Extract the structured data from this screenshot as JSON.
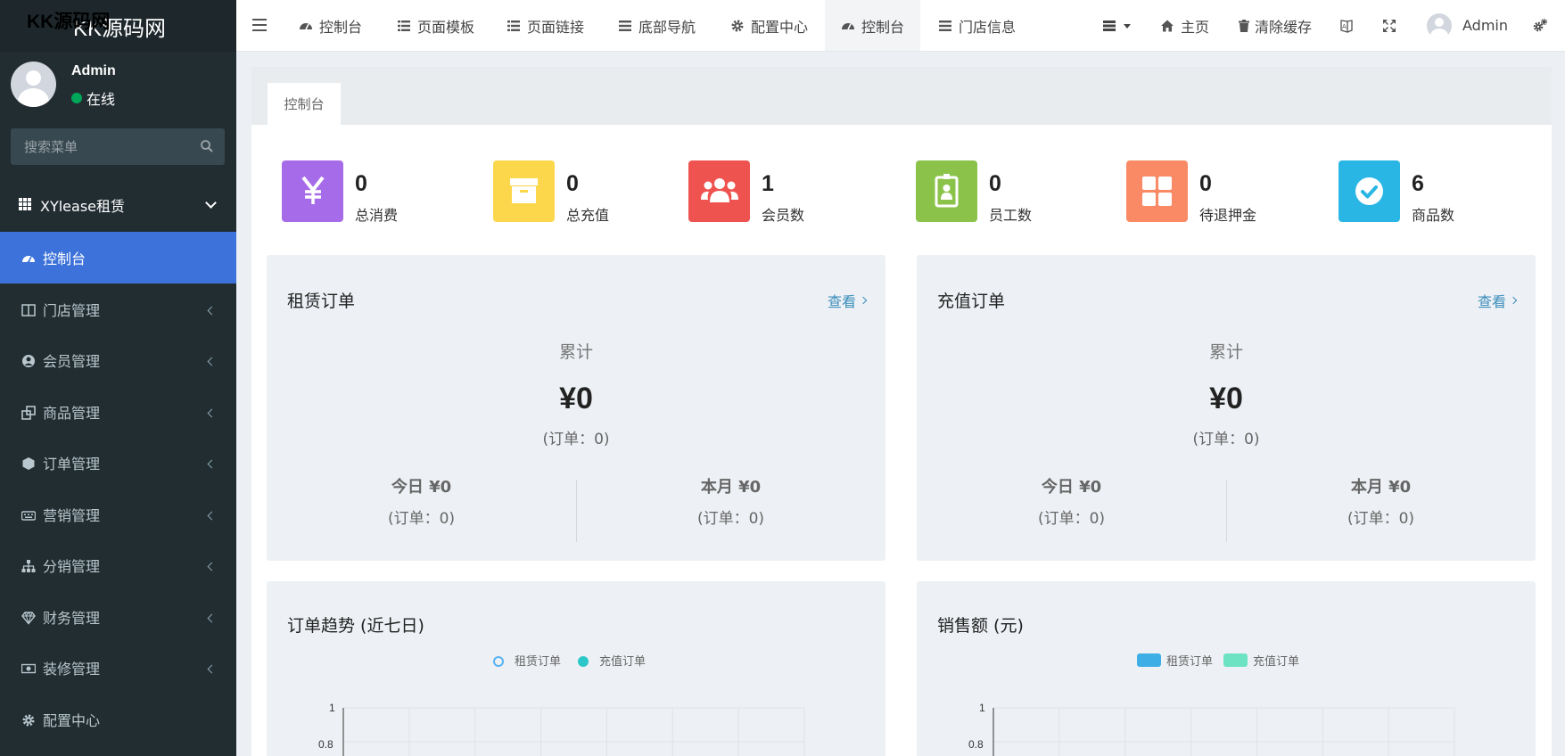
{
  "brand": {
    "logo": "KK源码网",
    "watermark": "KK源码网"
  },
  "user": {
    "name": "Admin",
    "status": "在线"
  },
  "sidebar": {
    "search_placeholder": "搜索菜单",
    "group": "XYlease租赁",
    "items": [
      {
        "label": "控制台",
        "icon": "dashboard-icon",
        "active": true
      },
      {
        "label": "门店管理",
        "icon": "columns-icon"
      },
      {
        "label": "会员管理",
        "icon": "user-circle-icon"
      },
      {
        "label": "商品管理",
        "icon": "clone-icon"
      },
      {
        "label": "订单管理",
        "icon": "cube-icon"
      },
      {
        "label": "营销管理",
        "icon": "keyboard-icon"
      },
      {
        "label": "分销管理",
        "icon": "sitemap-icon"
      },
      {
        "label": "财务管理",
        "icon": "diamond-icon"
      },
      {
        "label": "装修管理",
        "icon": "money-icon"
      },
      {
        "label": "配置中心",
        "icon": "gear-icon"
      }
    ]
  },
  "navbar": {
    "tabs": [
      {
        "label": "控制台",
        "icon": "dashboard-icon"
      },
      {
        "label": "页面模板",
        "icon": "list-icon"
      },
      {
        "label": "页面链接",
        "icon": "list-icon"
      },
      {
        "label": "底部导航",
        "icon": "bars-icon"
      },
      {
        "label": "配置中心",
        "icon": "gear-icon"
      },
      {
        "label": "控制台",
        "icon": "dashboard-icon",
        "active": true
      },
      {
        "label": "门店信息",
        "icon": "bars-icon"
      }
    ],
    "right": {
      "home": "主页",
      "clear_cache": "清除缓存",
      "admin": "Admin"
    }
  },
  "content": {
    "tab": "控制台",
    "stats": [
      {
        "value": "0",
        "label": "总消费",
        "color": "#a66be8",
        "icon": "yen-icon"
      },
      {
        "value": "0",
        "label": "总充值",
        "color": "#fdd74b",
        "icon": "archive-icon"
      },
      {
        "value": "1",
        "label": "会员数",
        "color": "#ef5350",
        "icon": "users-icon"
      },
      {
        "value": "0",
        "label": "员工数",
        "color": "#8bc34a",
        "icon": "id-badge-icon"
      },
      {
        "value": "0",
        "label": "待退押金",
        "color": "#fa8a65",
        "icon": "th-large-icon"
      },
      {
        "value": "6",
        "label": "商品数",
        "color": "#29b6e5",
        "icon": "check-circle-icon"
      }
    ],
    "rental": {
      "title": "租赁订单",
      "link": "查看",
      "cum_label": "累计",
      "cum_amount": "¥0",
      "cum_orders": "(订单：0)",
      "today": "今日 ¥0",
      "today_orders": "(订单：0)",
      "month": "本月 ¥0",
      "month_orders": "(订单：0)"
    },
    "recharge": {
      "title": "充值订单",
      "link": "查看",
      "cum_label": "累计",
      "cum_amount": "¥0",
      "cum_orders": "(订单：0)",
      "today": "今日 ¥0",
      "today_orders": "(订单：0)",
      "month": "本月 ¥0",
      "month_orders": "(订单：0)"
    }
  },
  "chart_data": [
    {
      "type": "line",
      "title": "订单趋势 (近七日)",
      "series": [
        {
          "name": "租赁订单",
          "values": []
        },
        {
          "name": "充值订单",
          "values": []
        }
      ],
      "colors": [
        "#5ab1ef",
        "#2ec7c9"
      ],
      "ylim": [
        0,
        1
      ],
      "yticks": [
        "1",
        "0.8"
      ]
    },
    {
      "type": "bar",
      "title": "销售额 (元)",
      "series": [
        {
          "name": "租赁订单",
          "values": []
        },
        {
          "name": "充值订单",
          "values": []
        }
      ],
      "colors": [
        "#3eaee6",
        "#6de3c4"
      ],
      "ylim": [
        0,
        1
      ],
      "yticks": [
        "1",
        "0.8"
      ]
    }
  ]
}
